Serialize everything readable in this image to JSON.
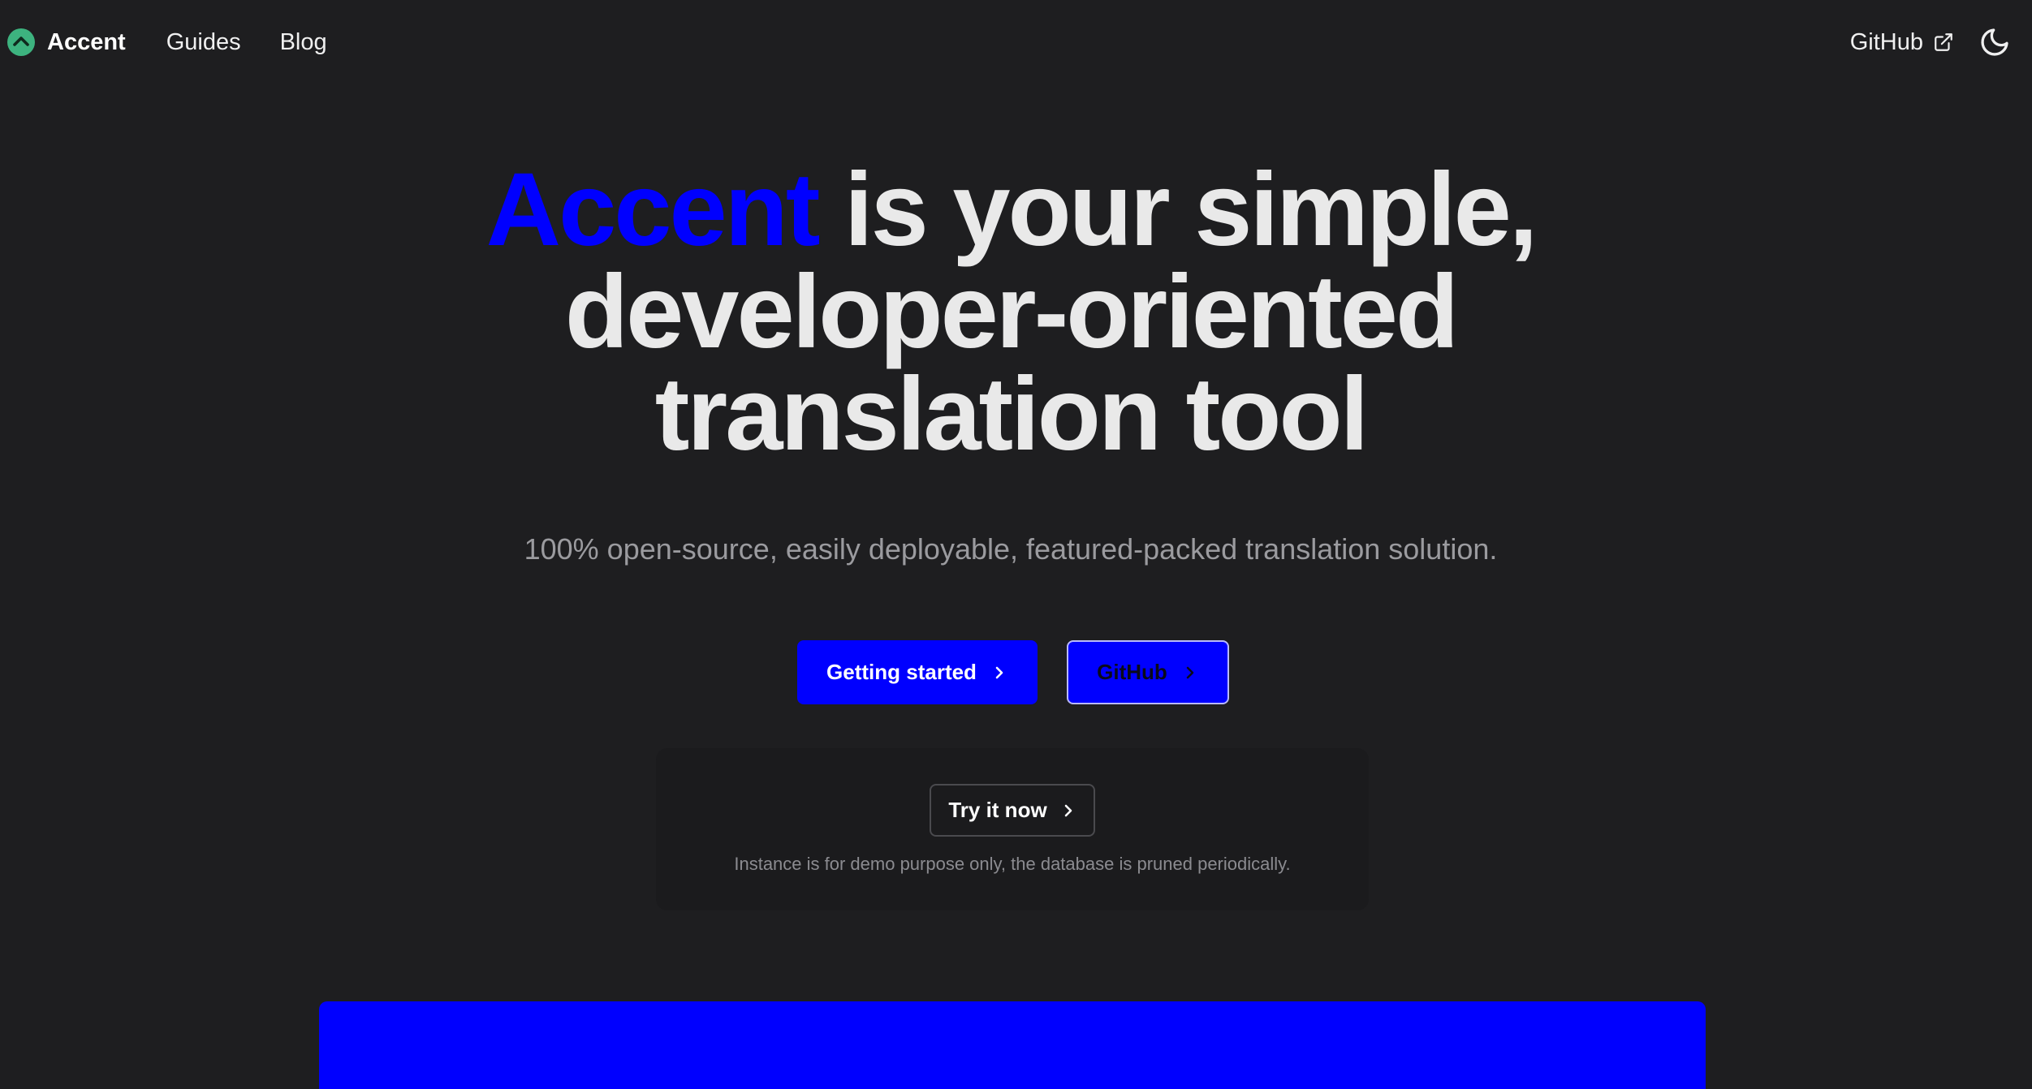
{
  "nav": {
    "brand_name": "Accent",
    "links": [
      {
        "label": "Guides"
      },
      {
        "label": "Blog"
      }
    ],
    "github_label": "GitHub",
    "icons": {
      "logo": "accent-logo-icon",
      "external": "external-link-icon",
      "theme": "moon-icon"
    }
  },
  "hero": {
    "title_accent": "Accent",
    "title_line1_rest": " is your simple,",
    "title_line2": "developer-oriented",
    "title_line3": "translation tool",
    "subtitle": "100% open-source, easily deployable, featured-packed translation solution."
  },
  "cta": {
    "primary_label": "Getting started",
    "secondary_label": "GitHub"
  },
  "demo": {
    "button_label": "Try it now",
    "note": "Instance is for demo purpose only, the database is pruned periodically."
  },
  "colors": {
    "accent": "#0000ff",
    "logo_green": "#3db37f",
    "background": "#1e1e20"
  }
}
